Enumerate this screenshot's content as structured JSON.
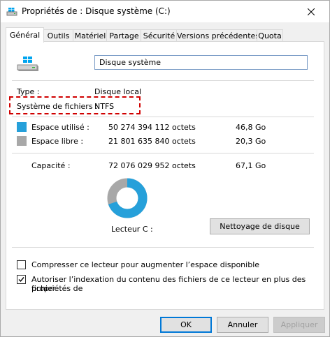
{
  "window": {
    "title": "Propriétés de : Disque système (C:)"
  },
  "tabs": [
    {
      "label": "Général",
      "active": true
    },
    {
      "label": "Outils"
    },
    {
      "label": "Matériel"
    },
    {
      "label": "Partage"
    },
    {
      "label": "Sécurité"
    },
    {
      "label": "Versions précédentes"
    },
    {
      "label": "Quota"
    }
  ],
  "general": {
    "drive_name": "Disque système",
    "type_label": "Type :",
    "type_value": "Disque local",
    "fs_label": "Système de fichiers :",
    "fs_value": "NTFS",
    "used_label": "Espace utilisé :",
    "used_bytes": "50 274 394 112 octets",
    "used_size": "46,8 Go",
    "free_label": "Espace libre :",
    "free_bytes": "21 801 635 840 octets",
    "free_size": "20,3 Go",
    "capacity_label": "Capacité :",
    "capacity_bytes": "72 076 029 952 octets",
    "capacity_size": "67,1 Go",
    "drive_label": "Lecteur C :",
    "cleanup_button": "Nettoyage de disque",
    "used_fraction": 0.698,
    "compress_label": "Compresser ce lecteur pour augmenter l’espace disponible",
    "compress_checked": false,
    "index_label_line1": "Autoriser l’indexation du contenu des fichiers de ce lecteur en plus des propriétés de",
    "index_label_line2": "fichier",
    "index_checked": true
  },
  "colors": {
    "used": "#26a0da",
    "free": "#a8a8a8",
    "highlight": "#d00000"
  },
  "footer": {
    "ok": "OK",
    "cancel": "Annuler",
    "apply": "Appliquer"
  }
}
